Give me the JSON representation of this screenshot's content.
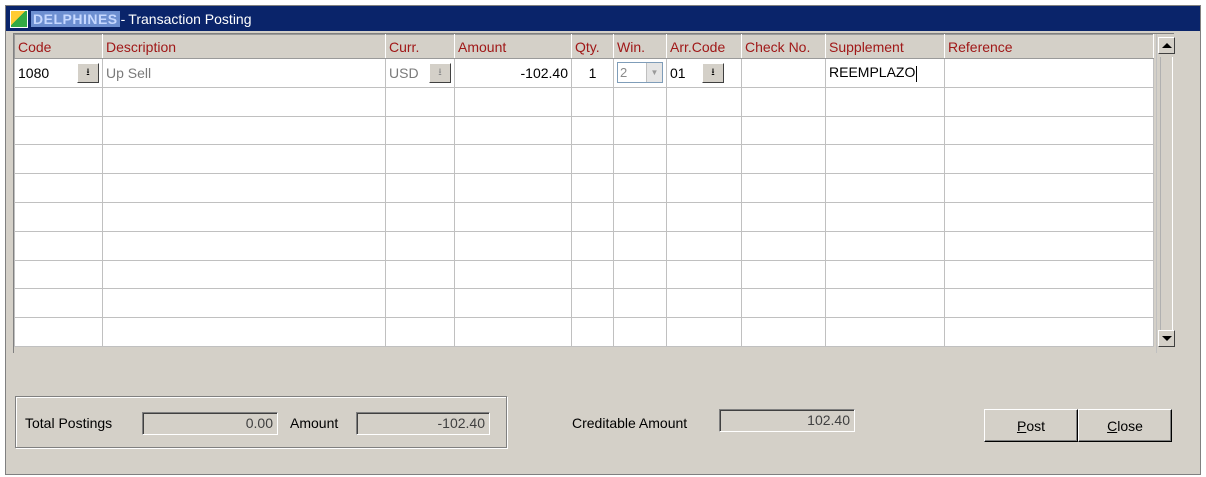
{
  "window": {
    "title_redacted": "DELPHINES",
    "title_sep": "-",
    "title": "Transaction Posting"
  },
  "grid": {
    "columns": [
      "Code",
      "Description",
      "Curr.",
      "Amount",
      "Qty.",
      "Win.",
      "Arr.Code",
      "Check No.",
      "Supplement",
      "Reference"
    ],
    "row1": {
      "code": "1080",
      "description": "Up Sell",
      "currency": "USD",
      "amount": "-102.40",
      "qty": "1",
      "window": "2",
      "arr_code": "01",
      "check_no": "",
      "supplement": "REEMPLAZO",
      "reference": ""
    }
  },
  "totals": {
    "total_postings_label": "Total Postings",
    "total_postings_value": "0.00",
    "amount_label": "Amount",
    "amount_value": "-102.40",
    "creditable_label": "Creditable Amount",
    "creditable_value": "102.40"
  },
  "buttons": {
    "post_u": "P",
    "post_rest": "ost",
    "close_u": "C",
    "close_rest": "lose"
  }
}
